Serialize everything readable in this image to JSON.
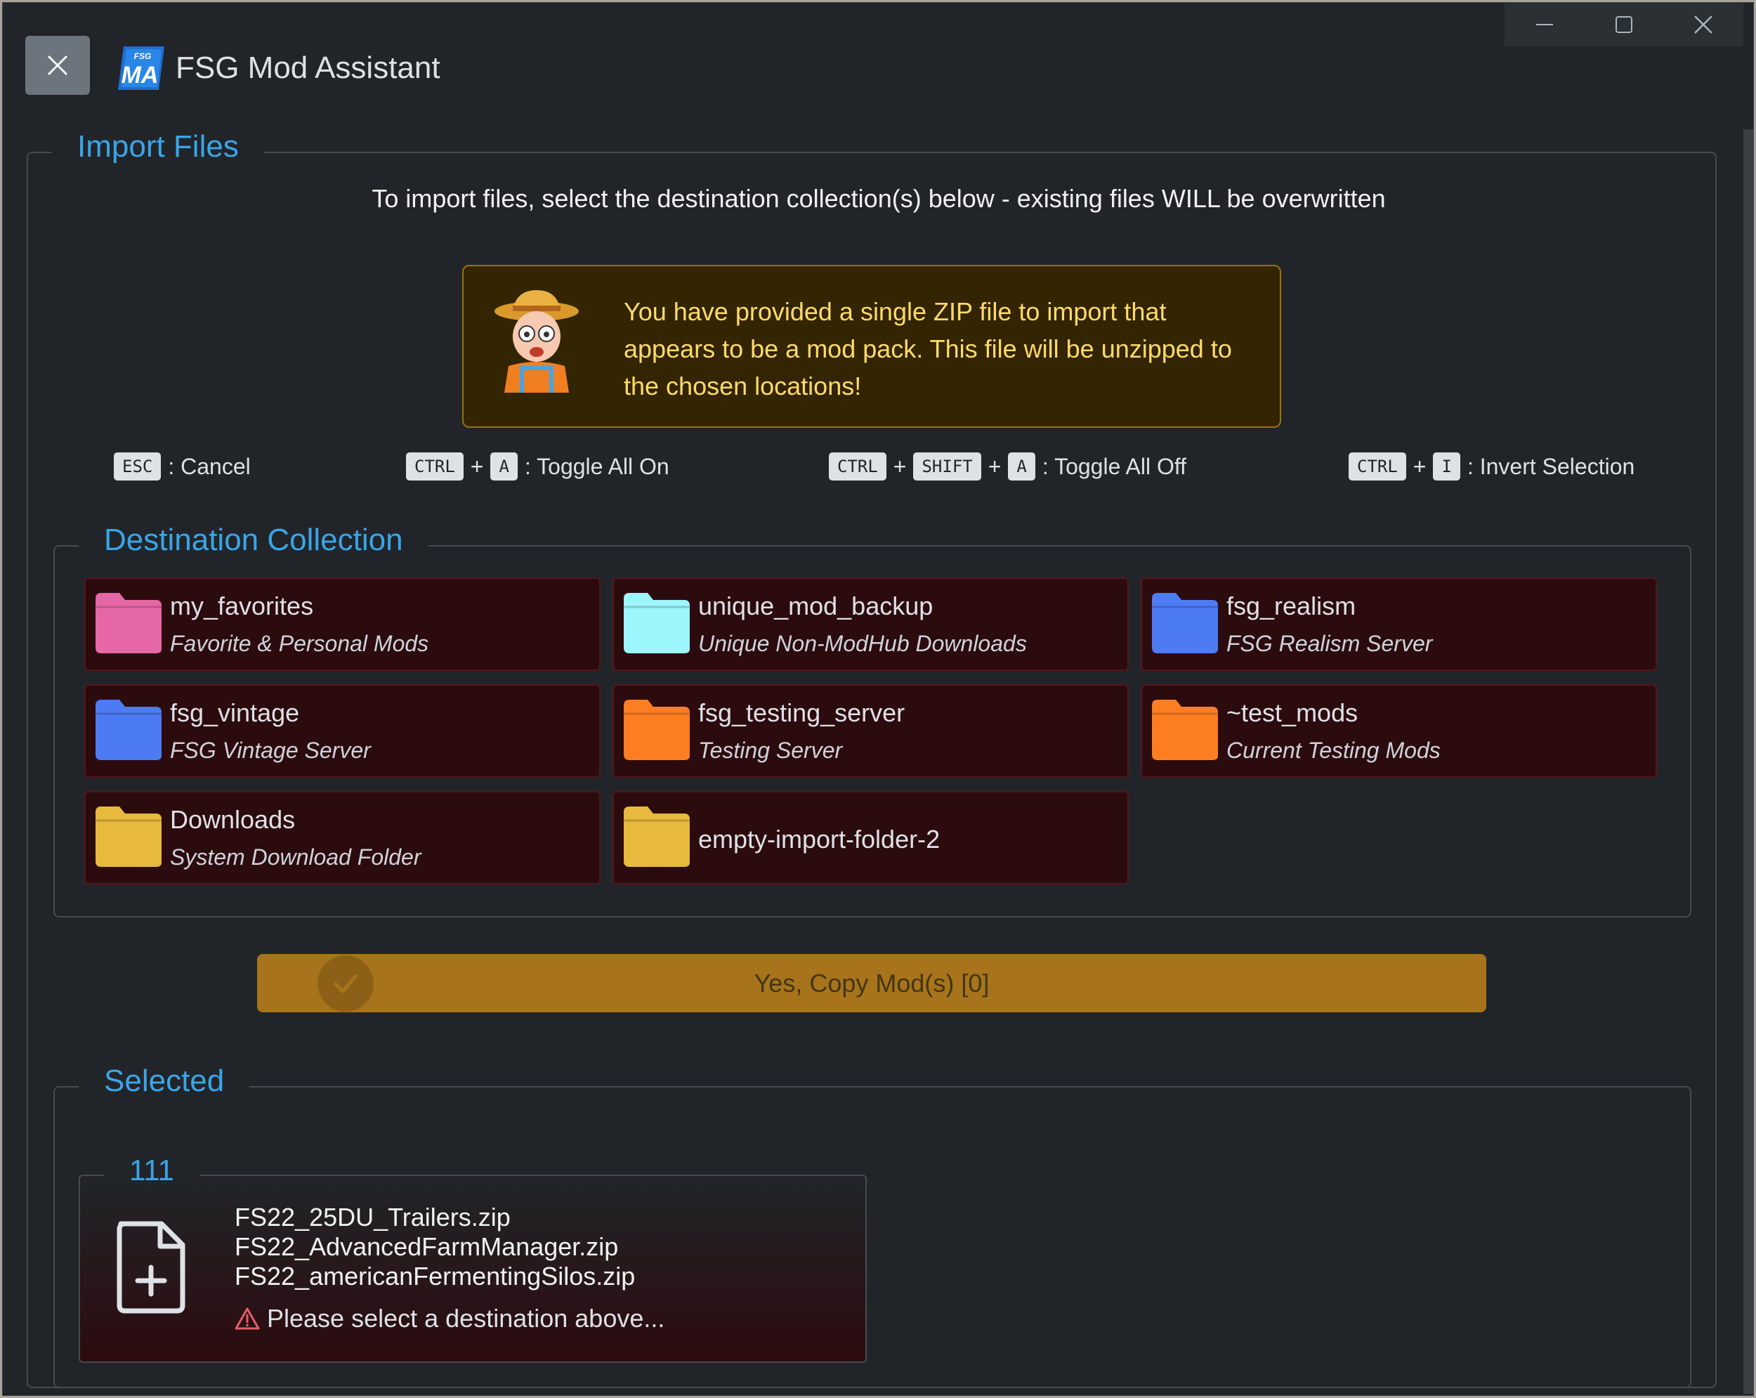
{
  "window": {
    "title": "FSG Mod Assistant",
    "logo_text_top": "FSG",
    "logo_text_main": "MA",
    "controls": {
      "minimize_icon": "minimize-icon",
      "maximize_icon": "maximize-icon",
      "close_icon": "close-icon"
    }
  },
  "import": {
    "legend": "Import Files",
    "intro": "To import files, select the destination collection(s) below - existing files WILL be overwritten",
    "warning": "You have provided a single ZIP file to import that appears to be a mod pack. This file will be unzipped to the chosen locations!"
  },
  "shortcuts": [
    {
      "keys": [
        "ESC"
      ],
      "action": ": Cancel"
    },
    {
      "keys": [
        "CTRL",
        "A"
      ],
      "action": ": Toggle All On"
    },
    {
      "keys": [
        "CTRL",
        "SHIFT",
        "A"
      ],
      "action": ": Toggle All Off"
    },
    {
      "keys": [
        "CTRL",
        "I"
      ],
      "action": ": Invert Selection"
    }
  ],
  "shortcut_plus": "+",
  "destination": {
    "legend": "Destination Collection",
    "collections": [
      {
        "name": "my_favorites",
        "desc": "Favorite & Personal Mods",
        "color": "#e667a5"
      },
      {
        "name": "unique_mod_backup",
        "desc": "Unique Non-ModHub Downloads",
        "color": "#9cf6fb"
      },
      {
        "name": "fsg_realism",
        "desc": "FSG Realism Server",
        "color": "#4d7bf3"
      },
      {
        "name": "fsg_vintage",
        "desc": "FSG Vintage Server",
        "color": "#4d7bf3"
      },
      {
        "name": "fsg_testing_server",
        "desc": "Testing Server",
        "color": "#fd7e21"
      },
      {
        "name": "~test_mods",
        "desc": "Current Testing Mods",
        "color": "#fd7e21"
      },
      {
        "name": "Downloads",
        "desc": "System Download Folder",
        "color": "#e7b93d"
      },
      {
        "name": "empty-import-folder-2",
        "desc": "",
        "color": "#e7b93d"
      }
    ]
  },
  "copy_button": {
    "label": "Yes, Copy Mod(s) [0]"
  },
  "selected": {
    "legend": "Selected",
    "group_label": "111",
    "files": [
      "FS22_25DU_Trailers.zip",
      "FS22_AdvancedFarmManager.zip",
      "FS22_americanFermentingSilos.zip"
    ],
    "warning": "Please select a destination above..."
  },
  "colors": {
    "accent": "#3aa5e8",
    "warning_text": "#ffda6a",
    "button": "#a7741b",
    "card_bg": "#2c0b0e"
  }
}
